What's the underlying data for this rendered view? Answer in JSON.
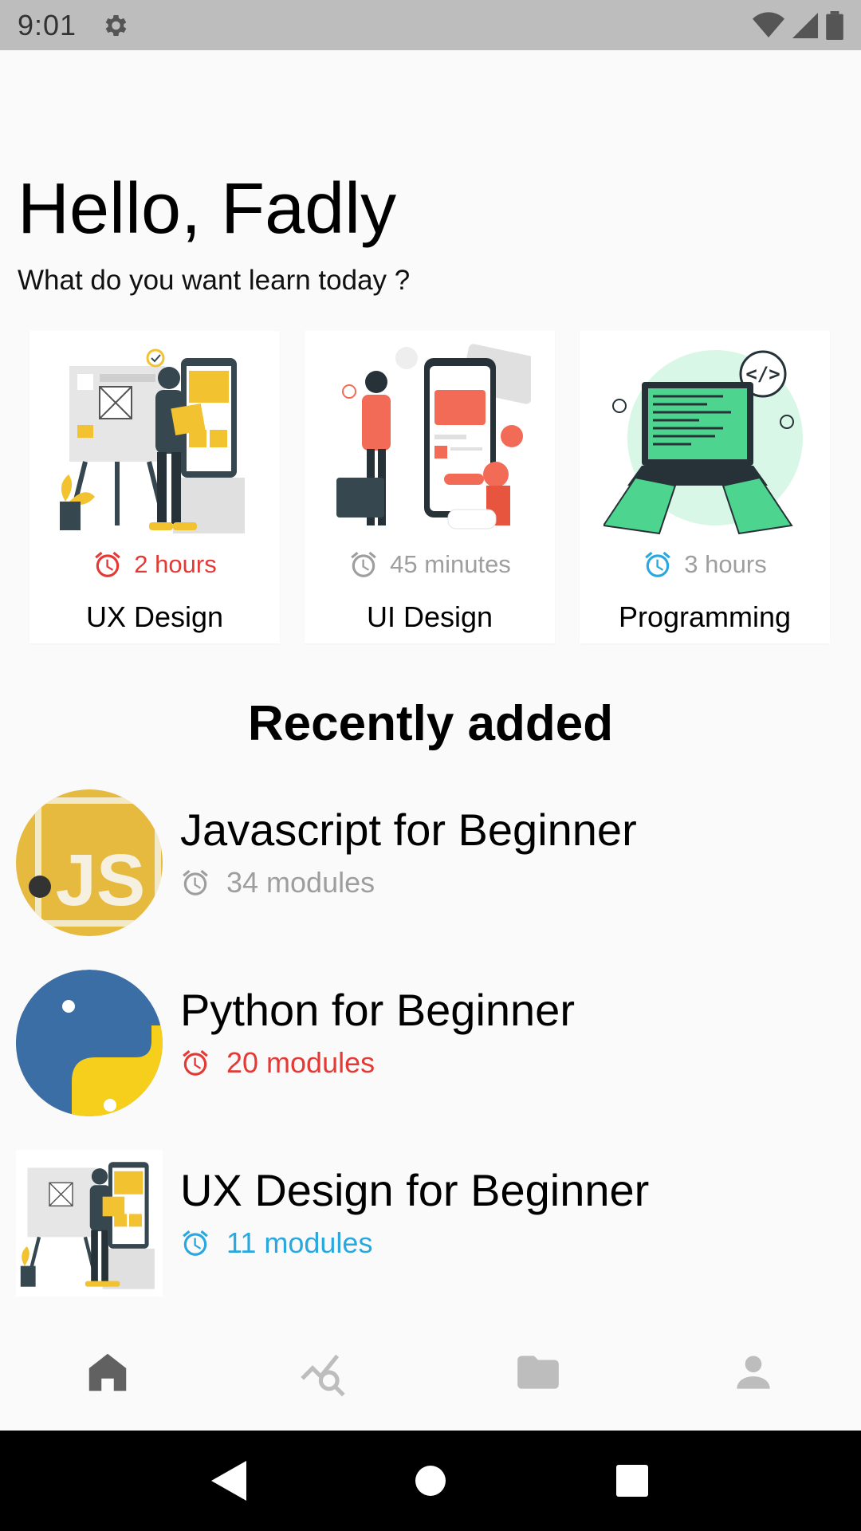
{
  "status_bar": {
    "time": "9:01"
  },
  "header": {
    "greeting": "Hello, Fadly",
    "subtitle": "What do you want learn today ?"
  },
  "courses": [
    {
      "title": "UX Design",
      "duration": "2 hours",
      "color": "#e53935",
      "illustration": "ux-design-illustration"
    },
    {
      "title": "UI Design",
      "duration": "45 minutes",
      "color": "#9e9e9e",
      "illustration": "ui-design-illustration"
    },
    {
      "title": "Programming",
      "duration": "3 hours",
      "color": "#29a8e0",
      "illustration": "programming-illustration"
    }
  ],
  "recent": {
    "title": "Recently added",
    "items": [
      {
        "title": "Javascript for Beginner",
        "modules": "34 modules",
        "color": "#9e9e9e",
        "thumb": "javascript-logo"
      },
      {
        "title": "Python for Beginner",
        "modules": "20 modules",
        "color": "#e53935",
        "thumb": "python-logo"
      },
      {
        "title": "UX Design for Beginner",
        "modules": "11 modules",
        "color": "#29a8e0",
        "thumb": "ux-design-thumbnail"
      }
    ]
  },
  "bottom_nav": {
    "items": [
      {
        "name": "home",
        "active": true
      },
      {
        "name": "analytics",
        "active": false
      },
      {
        "name": "folder",
        "active": false
      },
      {
        "name": "profile",
        "active": false
      }
    ]
  }
}
